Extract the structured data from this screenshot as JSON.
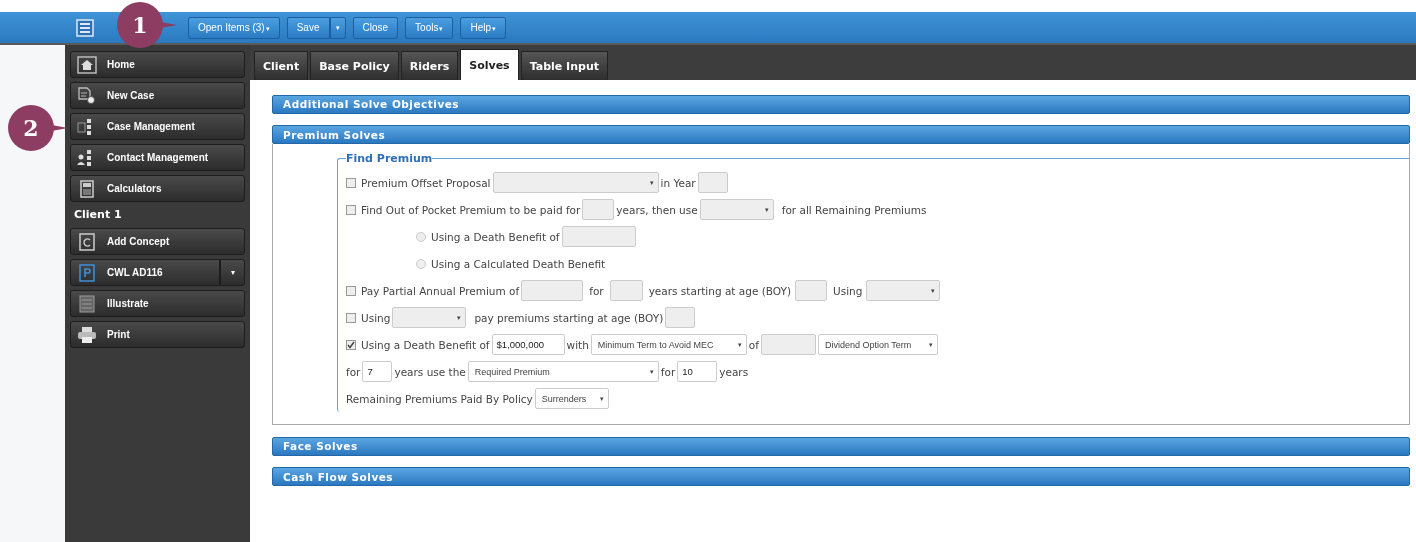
{
  "toolbar": {
    "buttons": [
      {
        "label": "Open Items (3)",
        "caret": "▾"
      },
      {
        "label": "Save",
        "split_caret": "▾"
      },
      {
        "label": "Close"
      },
      {
        "label": "Tools",
        "caret": "▾"
      },
      {
        "label": "Help",
        "caret": "▾"
      }
    ]
  },
  "callouts": [
    {
      "text": "1"
    },
    {
      "text": "2"
    }
  ],
  "sidebar": {
    "items": [
      {
        "kind": "button",
        "label": "Home"
      },
      {
        "kind": "button",
        "label": "New Case"
      },
      {
        "kind": "button",
        "label": "Case Management"
      },
      {
        "kind": "button",
        "label": "Contact Management"
      },
      {
        "kind": "button",
        "label": "Calculators"
      },
      {
        "kind": "heading",
        "label": "Client 1"
      },
      {
        "kind": "button",
        "label": "Add Concept"
      },
      {
        "kind": "split",
        "label": "CWL AD116",
        "caret": "▾"
      },
      {
        "kind": "button",
        "label": "Illustrate"
      },
      {
        "kind": "button",
        "label": "Print"
      }
    ]
  },
  "tabs": [
    {
      "label": "Client",
      "selected": false
    },
    {
      "label": "Base Policy",
      "selected": false
    },
    {
      "label": "Riders",
      "selected": false
    },
    {
      "label": "Solves",
      "selected": true
    },
    {
      "label": "Table Input",
      "selected": false
    }
  ],
  "sections": [
    {
      "title": "Additional Solve Objectives"
    },
    {
      "title": "Premium Solves",
      "fieldset": {
        "legend": "Find Premium",
        "rows": [
          {
            "items": [
              {
                "kind": "checkbox",
                "checked": false
              },
              {
                "kind": "text",
                "text": "Premium Offset Proposal"
              },
              {
                "kind": "select",
                "caret": "▾"
              },
              {
                "kind": "text",
                "text": "in Year"
              },
              {
                "kind": "input"
              }
            ]
          },
          {
            "items": [
              {
                "kind": "checkbox",
                "checked": false
              },
              {
                "kind": "text",
                "text": "Find Out of Pocket Premium to be paid for"
              },
              {
                "kind": "input"
              },
              {
                "kind": "text",
                "text": "years, then use"
              },
              {
                "kind": "select",
                "caret": "▾"
              },
              {
                "kind": "text",
                "text": "for all Remaining Premiums"
              }
            ]
          },
          {
            "items": [
              {
                "kind": "radio",
                "selected": false
              },
              {
                "kind": "text",
                "text": "Using a Death Benefit of"
              },
              {
                "kind": "input"
              }
            ]
          },
          {
            "items": [
              {
                "kind": "radio",
                "selected": false
              },
              {
                "kind": "text",
                "text": "Using a Calculated Death Benefit"
              }
            ]
          },
          {
            "items": [
              {
                "kind": "checkbox",
                "checked": false
              },
              {
                "kind": "text",
                "text": "Pay Partial Annual Premium of"
              },
              {
                "kind": "input"
              },
              {
                "kind": "text",
                "text": "for"
              },
              {
                "kind": "input"
              },
              {
                "kind": "text",
                "text": "years starting at age (BOY)"
              },
              {
                "kind": "input"
              },
              {
                "kind": "text",
                "text": "Using"
              },
              {
                "kind": "select",
                "caret": "▾"
              }
            ]
          },
          {
            "items": [
              {
                "kind": "checkbox",
                "checked": false
              },
              {
                "kind": "text",
                "text": "Using"
              },
              {
                "kind": "select",
                "caret": "▾"
              },
              {
                "kind": "text",
                "text": "pay premiums starting at age (BOY)"
              },
              {
                "kind": "input"
              }
            ]
          },
          {
            "items": [
              {
                "kind": "checkbox",
                "checked": true
              },
              {
                "kind": "text",
                "text": "Using a Death Benefit of"
              },
              {
                "kind": "input",
                "value": "$1,000,000"
              },
              {
                "kind": "text",
                "text": "with"
              },
              {
                "kind": "select",
                "value": "Minimum Term to Avoid MEC",
                "caret": "▾"
              },
              {
                "kind": "text",
                "text": "of"
              },
              {
                "kind": "input"
              },
              {
                "kind": "select",
                "value": "Dividend Option Term",
                "caret": "▾"
              }
            ]
          },
          {
            "items": [
              {
                "kind": "text",
                "text": "for"
              },
              {
                "kind": "input",
                "value": "7"
              },
              {
                "kind": "text",
                "text": "years use the"
              },
              {
                "kind": "select",
                "value": "Required Premium",
                "caret": "▾"
              },
              {
                "kind": "text",
                "text": "for"
              },
              {
                "kind": "input",
                "value": "10"
              },
              {
                "kind": "text",
                "text": "years"
              }
            ]
          },
          {
            "items": [
              {
                "kind": "text",
                "text": "Remaining Premiums Paid By Policy"
              },
              {
                "kind": "select",
                "value": "Surrenders",
                "caret": "▾"
              }
            ]
          }
        ]
      }
    },
    {
      "title": "Face Solves"
    },
    {
      "title": "Cash Flow Solves"
    }
  ]
}
